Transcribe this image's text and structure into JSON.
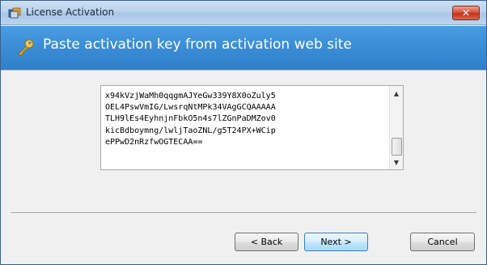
{
  "window": {
    "title": "License Activation",
    "close_label": "✕",
    "icon": "app-icon"
  },
  "header": {
    "icon": "key-icon",
    "text": "Paste activation key from activation web site",
    "background": "#3d8fd8"
  },
  "key_field": {
    "lines": [
      "x94kVzjWaMh0qqgmAJYeGw339Y8X0oZuly5",
      "OEL4PswVmIG/LwsrqNtMPk34VAgGCQAAAAA",
      "TLH9lEs4EyhnjnFbkO5n4s7lZGnPaDMZov0",
      "kicBdboymng/lwljTaoZNL/g5T24PX+WCip",
      "ePPwD2nRzfwOGTECAA=="
    ]
  },
  "buttons": {
    "back": "< Back",
    "next": "Next >",
    "cancel": "Cancel"
  }
}
